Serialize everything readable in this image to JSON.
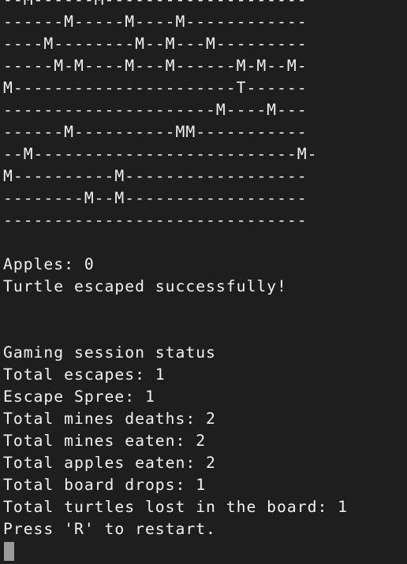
{
  "board": {
    "rows": [
      "--M------M--------------------",
      "------M-----M----M------------",
      "----M--------M--M---M---------",
      "-----M-M----M---M------M-M--M-",
      "M----------------------T------",
      "---------------------M----M---",
      "------M----------MM-----------",
      "--M--------------------------M-",
      "M----------M------------------",
      "--------M--M------------------",
      "------------------------------"
    ]
  },
  "status": {
    "apples": "Apples: 0",
    "message": "Turtle escaped successfully!"
  },
  "session": {
    "title": "Gaming session status",
    "total_escapes": "Total escapes: 1",
    "escape_spree": "Escape Spree: 1",
    "mines_deaths": "Total mines deaths: 2",
    "mines_eaten": "Total mines eaten: 2",
    "apples_eaten": "Total apples eaten: 2",
    "board_drops": "Total board drops: 1",
    "turtles_lost": "Total turtles lost in the board: 1",
    "restart_prompt": "Press 'R' to restart."
  }
}
